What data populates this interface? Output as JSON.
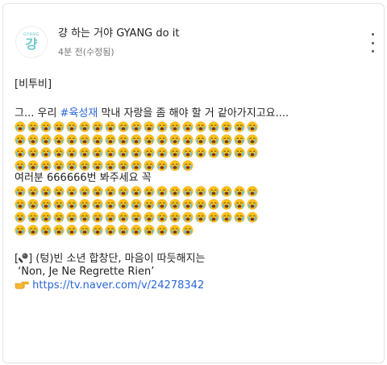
{
  "post": {
    "channel_name": "걍 하는 거야 GYANG do it",
    "time": "4분 전(수정됨)",
    "avatar": {
      "top_text": "GYANG",
      "main_text": "걍",
      "accent": "#6fc7c9"
    },
    "more_icon": "more-vertical-icon"
  },
  "content": {
    "tag_line": "[비투비]",
    "line1_prefix": "그... 우리 ",
    "hashtag": "#육성재",
    "line1_suffix": " 막내 자랑을 좀 해야 할 거 같아가지고요....",
    "emoji_name": "loudly-crying-face-icon",
    "emoji_block1_rows": [
      19,
      19,
      19,
      14
    ],
    "line2": "여러분 666666번 봐주세요 꼭",
    "emoji_block2_rows": [
      19,
      19,
      19,
      14
    ],
    "line3_icon": "microphone-icon",
    "line3_open": "[",
    "line3_close": "] (텅)빈 소년 합창단, 마음이 따듯해지는",
    "line4": "‘Non, Je Ne Regrette Rien’",
    "line5_icon": "pointing-hand-icon",
    "link": "https://tv.naver.com/v/24278342",
    "link_color": "#2a66d6"
  }
}
